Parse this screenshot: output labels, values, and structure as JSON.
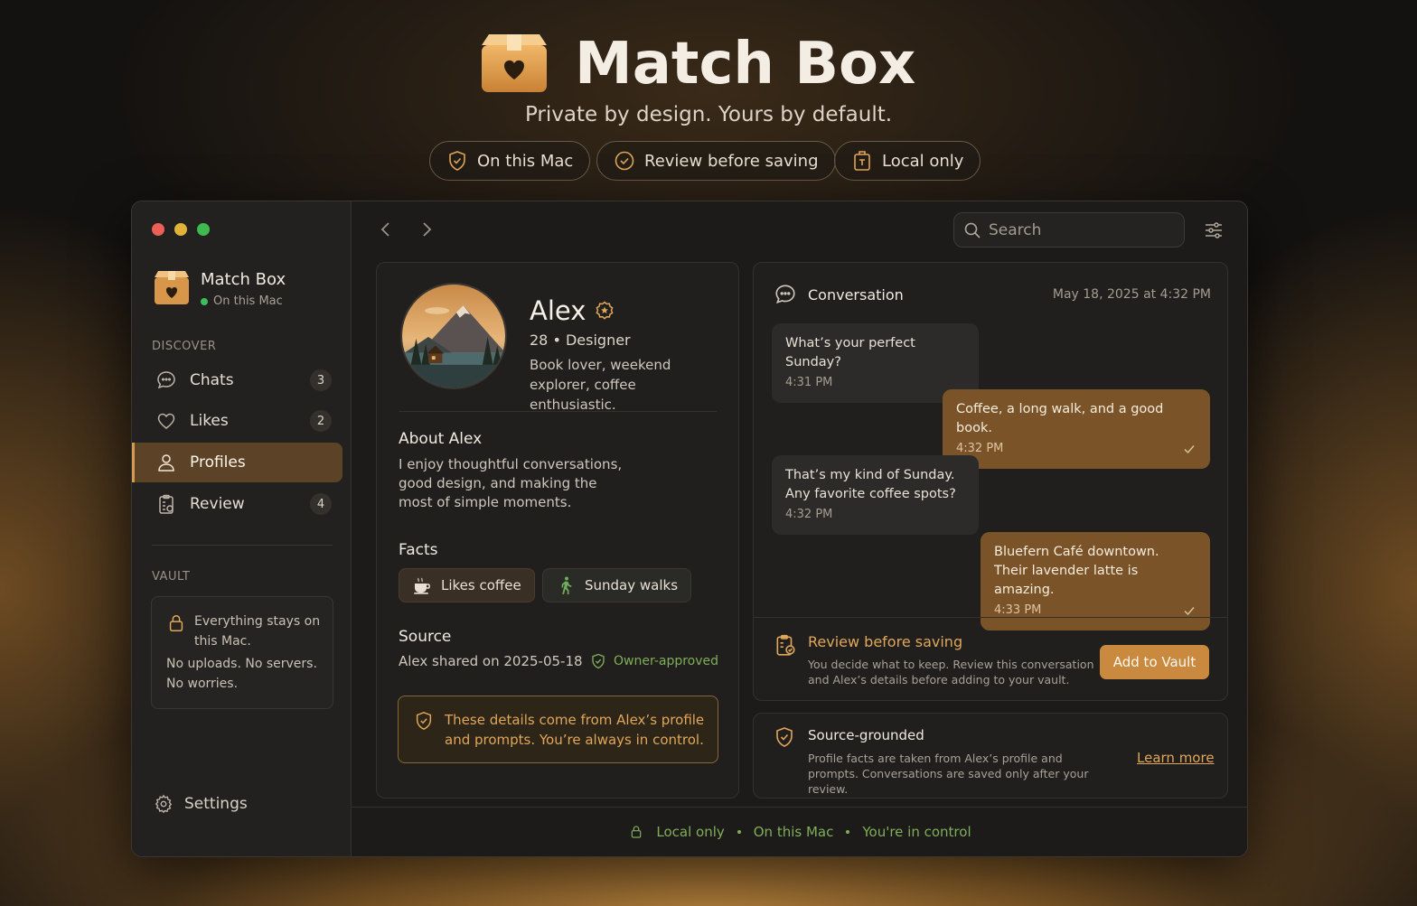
{
  "hero": {
    "title": "Match Box",
    "tagline": "Private by design. Yours by default.",
    "pills": [
      {
        "label": "On this Mac",
        "icon": "shield-check-icon"
      },
      {
        "label": "Review before saving",
        "icon": "check-circle-icon"
      },
      {
        "label": "Local only",
        "icon": "local-box-icon"
      }
    ]
  },
  "app": {
    "name": "Match Box",
    "status": "On this Mac"
  },
  "sidebar": {
    "discover_label": "DISCOVER",
    "items": [
      {
        "label": "Chats",
        "count": "3",
        "icon": "chat-bubble-icon"
      },
      {
        "label": "Likes",
        "count": "2",
        "icon": "heart-icon"
      },
      {
        "label": "Profiles",
        "icon": "person-icon",
        "active": true
      },
      {
        "label": "Review",
        "count": "4",
        "icon": "clipboard-icon"
      }
    ],
    "vault_label": "VAULT",
    "vault_line1": "Everything stays on this Mac.",
    "vault_line2": "No uploads. No servers. No worries.",
    "settings_label": "Settings"
  },
  "toolbar": {
    "search_placeholder": "Search"
  },
  "profile": {
    "name": "Alex",
    "meta": "28 • Designer",
    "bio": "Book lover, weekend explorer, coffee enthusiastic.",
    "about_heading": "About Alex",
    "about_text": "I enjoy thoughtful conversations, good design, and making the most of simple moments.",
    "facts_heading": "Facts",
    "facts": [
      {
        "label": "Likes coffee",
        "icon": "coffee-cup-icon"
      },
      {
        "label": "Sunday walks",
        "icon": "walking-person-icon"
      }
    ],
    "source_heading": "Source",
    "source_text": "Alex shared on 2025-05-18",
    "approved_label": "Owner-approved",
    "notice": "These details come from Alex’s profile and prompts. You’re always in control."
  },
  "conversation": {
    "title": "Conversation",
    "date": "May 18, 2025 at 4:32 PM",
    "messages": [
      {
        "dir": "in",
        "text": "What’s your perfect Sunday?",
        "time": "4:31 PM"
      },
      {
        "dir": "out",
        "text": "Coffee, a long walk, and a good book.",
        "time": "4:32 PM"
      },
      {
        "dir": "in",
        "text": "That’s my kind of Sunday. Any favorite coffee spots?",
        "time": "4:32 PM"
      },
      {
        "dir": "out",
        "text": "Bluefern Café downtown. Their lavender latte is amazing.",
        "time": "4:33 PM"
      }
    ],
    "review_title": "Review before saving",
    "review_text": "You decide what to keep. Review this conversation and Alex’s details before adding to your vault.",
    "add_button": "Add to Vault"
  },
  "source_grounded": {
    "title": "Source-grounded",
    "text": "Profile facts are taken from Alex’s profile and prompts. Conversations are saved only after your review.",
    "link": "Learn more"
  },
  "footer": {
    "items": [
      "Local only",
      "On this Mac",
      "You're in control"
    ]
  },
  "colors": {
    "accent": "#c98a3f",
    "accent_text": "#e0a659",
    "success": "#7fae58",
    "bg": "#1c1b1a"
  }
}
